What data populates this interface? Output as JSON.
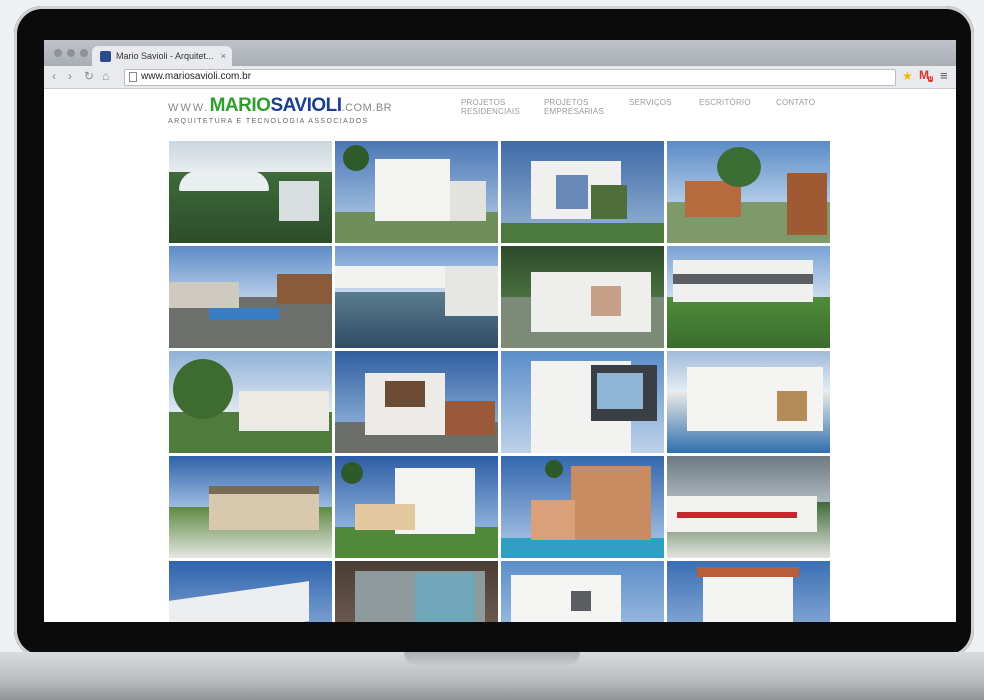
{
  "browser": {
    "tab_title": "Mario Savioli - Arquitet...",
    "tab_close": "×",
    "url": "www.mariosavioli.com.br",
    "back_icon": "‹",
    "forward_icon": "›",
    "reload_icon": "↻",
    "home_icon": "⌂",
    "star_icon": "★",
    "gmail_icon": "M",
    "gmail_badge": "0",
    "menu_icon": "≡"
  },
  "site": {
    "logo_www": "WWW.",
    "logo_brand_a": "MARIO",
    "logo_brand_b": "SAVIOLI",
    "logo_domain": ".COM.BR",
    "logo_tagline": "ARQUITETURA E TECNOLOGIA ASSOCIADOS",
    "nav": [
      {
        "line1": "PROJETOS",
        "line2": "RESIDENCIAIS"
      },
      {
        "line1": "PROJETOS",
        "line2": "EMPRESARIAS"
      },
      {
        "line1": "SERVIÇOS",
        "line2": ""
      },
      {
        "line1": "ESCRITÓRIO",
        "line2": ""
      },
      {
        "line1": "CONTATO",
        "line2": ""
      }
    ]
  },
  "colors": {
    "brand_green": "#2e9e2e",
    "brand_blue": "#1a3f8f"
  }
}
